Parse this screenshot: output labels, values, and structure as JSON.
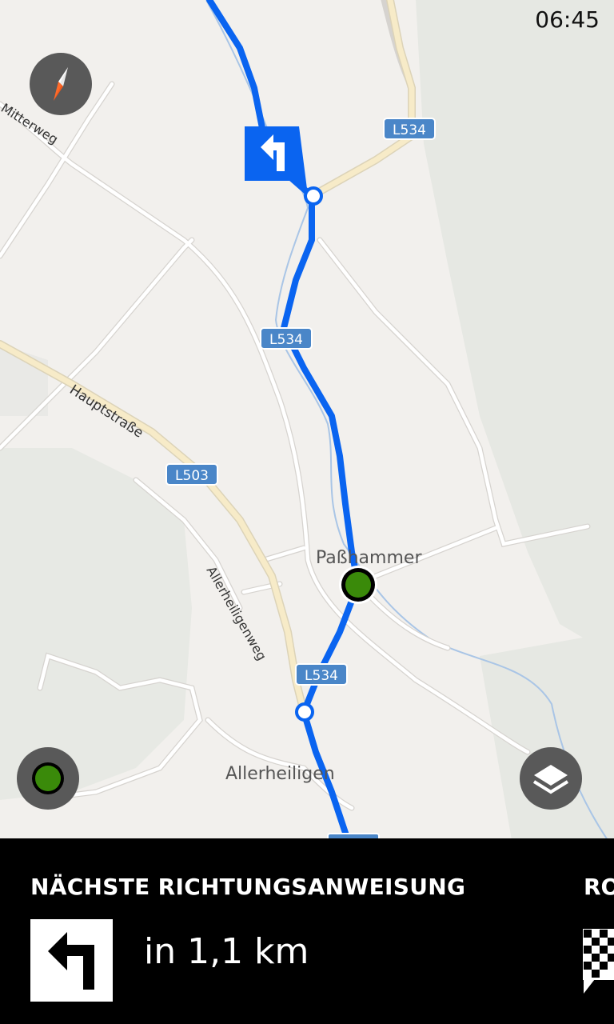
{
  "status_bar": {
    "time": "06:45"
  },
  "map": {
    "route_color": "#0a64f0",
    "current_position_color": "#3a8a0a",
    "road_labels": [
      {
        "name": "Mitterweg"
      },
      {
        "name": "Hauptstraße"
      },
      {
        "name": "Allerheiligenweg"
      }
    ],
    "place_labels": [
      {
        "name": "Paßhammer"
      },
      {
        "name": "Allerheiligen"
      }
    ],
    "route_shields": [
      "L534",
      "L534",
      "L503",
      "L534"
    ],
    "turn_marker_icon": "turn-left-arrow-icon"
  },
  "controls": {
    "compass_icon": "compass-icon",
    "locate_icon": "current-location-icon",
    "layers_icon": "layers-icon"
  },
  "guidance": {
    "heading": "NÄCHSTE RICHTUNGSANWEISUNG",
    "next_heading_partial": "RO",
    "turn_icon": "turn-left-arrow-icon",
    "distance": "in 1,1 km",
    "destination_icon": "checkered-flag-icon"
  }
}
